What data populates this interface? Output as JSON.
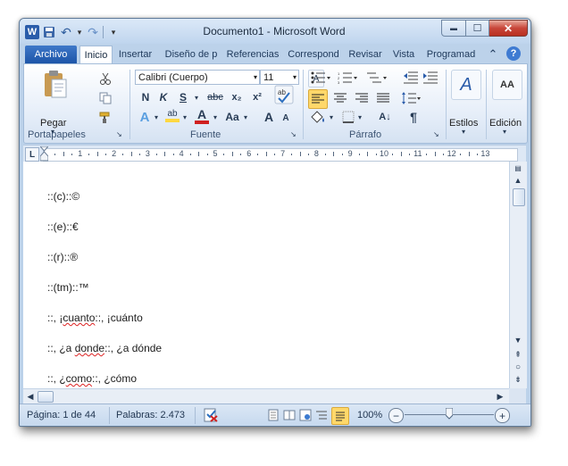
{
  "window": {
    "title": "Documento1 - Microsoft Word",
    "min_glyph": "▬",
    "max_glyph": "☐",
    "close_glyph": "✕"
  },
  "qat": {
    "word_glyph": "W",
    "save_glyph": "💾",
    "undo_glyph": "↶",
    "redo_glyph": "↷",
    "more_glyph": "▾"
  },
  "tabs": {
    "file": "Archivo",
    "items": [
      "Inicio",
      "Insertar",
      "Diseño de p",
      "Referencias",
      "Correspond",
      "Revisar",
      "Vista",
      "Programad"
    ],
    "collapse_glyph": "⌃",
    "help_glyph": "?"
  },
  "ribbon": {
    "clipboard": {
      "paste_label": "Pegar",
      "group_label": "Portapapeles"
    },
    "font": {
      "font_name": "Calibri (Cuerpo)",
      "font_size": "11",
      "grow": "A",
      "shrink": "A",
      "clear": "A",
      "bold": "N",
      "italic": "K",
      "underline": "S",
      "strike": "abc",
      "sub": "x₂",
      "sup": "x²",
      "effects": "A",
      "highlight": "ab",
      "color": "A",
      "case": "Aa",
      "grow2": "A",
      "shrink2": "A",
      "group_label": "Fuente"
    },
    "paragraph": {
      "group_label": "Párrafo",
      "pilcrow": "¶",
      "sort": "A↓"
    },
    "styles": {
      "label": "Estilos",
      "glyph": "A"
    },
    "editing": {
      "label": "Edición",
      "glyph": "AA"
    }
  },
  "ruler": {
    "numbers": [
      "1",
      "2",
      "3",
      "4",
      "5",
      "6",
      "7",
      "8",
      "9",
      "10",
      "11",
      "12",
      "13"
    ],
    "tab_glyph": "L"
  },
  "document": {
    "lines": [
      {
        "a": "::(c)::©",
        "b": ""
      },
      {
        "a": "::(e)::€",
        "b": ""
      },
      {
        "a": "::(r)::®",
        "b": ""
      },
      {
        "a": "::(tm)::™",
        "b": ""
      },
      {
        "a": "::, ¡",
        "u": "cuanto",
        "b": "::, ¡cuánto"
      },
      {
        "a": "::, ¿a ",
        "u": "donde",
        "b": "::, ¿a dónde"
      },
      {
        "a": "::, ¿",
        "u": "como",
        "b": "::, ¿cómo"
      }
    ]
  },
  "statusbar": {
    "page": "Página: 1 de 44",
    "words": "Palabras: 2.473",
    "zoom": "100%",
    "zoom_level": 1.0,
    "zoom_minus": "−",
    "zoom_plus": "+"
  },
  "colors": {
    "file_tab": "#1d55a8",
    "accent_red": "#d02020",
    "highlight_yellow": "#ffd840"
  }
}
